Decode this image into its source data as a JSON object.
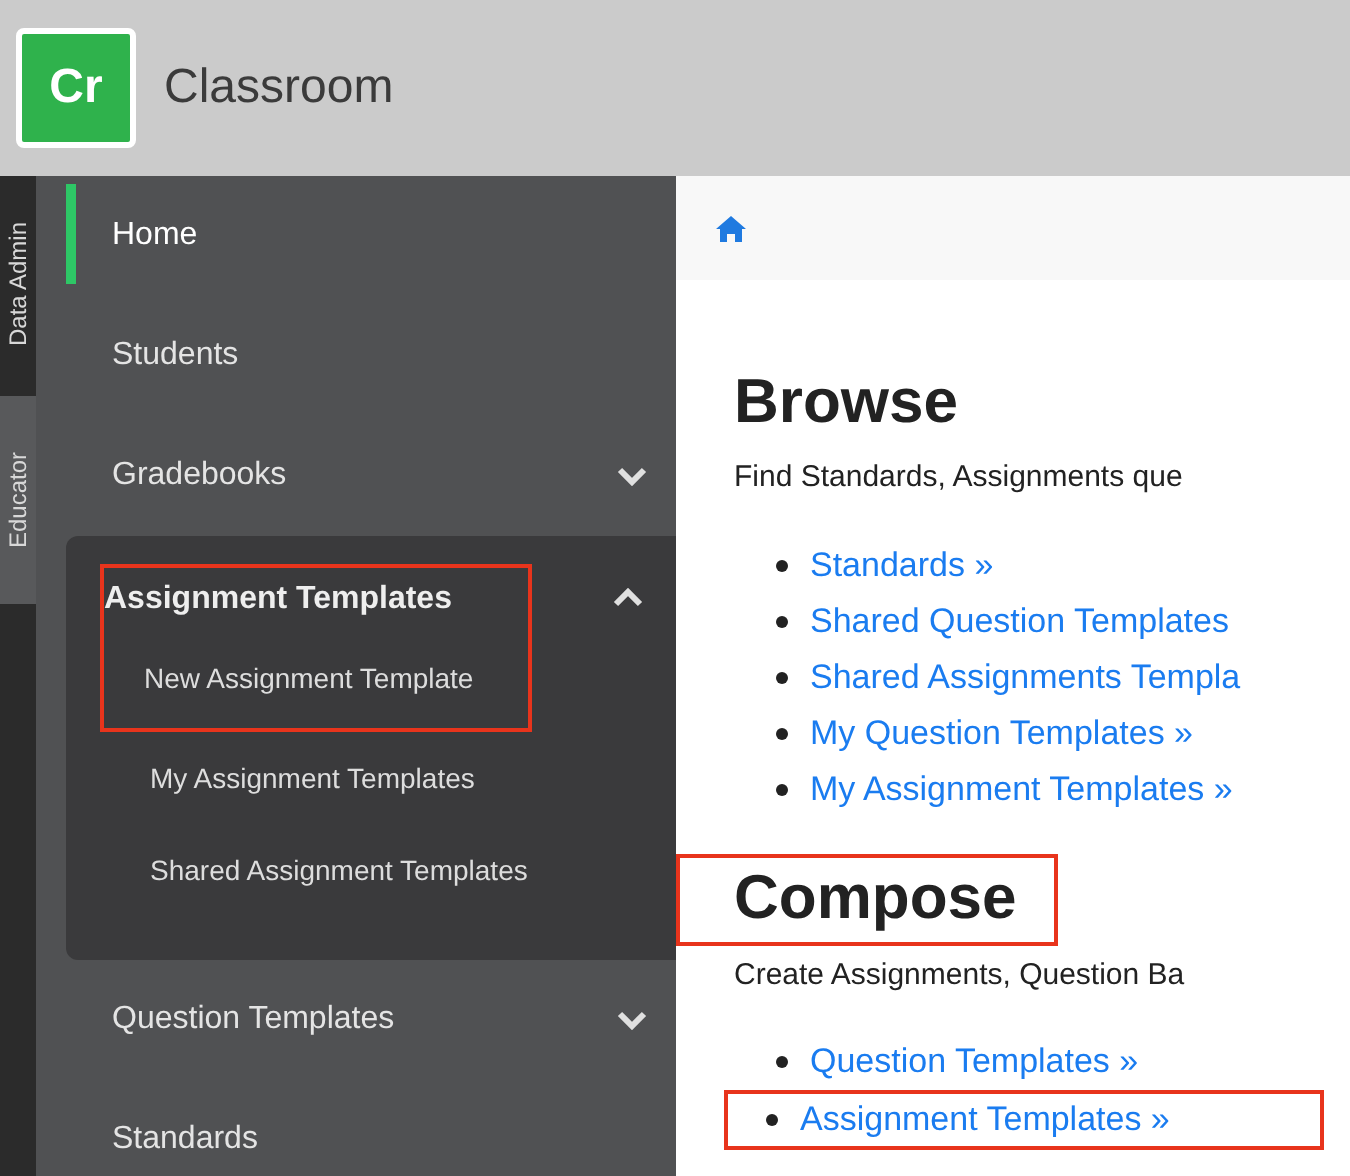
{
  "header": {
    "logo": "Cr",
    "title": "Classroom"
  },
  "role_tabs": [
    {
      "label": "Data Admin",
      "selected": false
    },
    {
      "label": "Educator",
      "selected": true
    }
  ],
  "sidebar": {
    "items": [
      {
        "label": "Home",
        "kind": "link",
        "selected": true
      },
      {
        "label": "Students",
        "kind": "link",
        "selected": false
      },
      {
        "label": "Gradebooks",
        "kind": "group",
        "expanded": false,
        "selected": false
      },
      {
        "label": "Assignment Templates",
        "kind": "group",
        "expanded": true,
        "selected": false,
        "annotated": true,
        "children": [
          {
            "label": "New Assignment Template"
          },
          {
            "label": "My Assignment Templates"
          },
          {
            "label": "Shared Assignment Templates"
          }
        ]
      },
      {
        "label": "Question Templates",
        "kind": "group",
        "expanded": false,
        "selected": false
      },
      {
        "label": "Standards",
        "kind": "link",
        "selected": false
      }
    ]
  },
  "sections": [
    {
      "heading": "Browse",
      "annotated": false,
      "description": "Find Standards, Assignments que",
      "links": [
        {
          "label": "Standards »",
          "annotated": false
        },
        {
          "label": "Shared Question Templates",
          "annotated": false
        },
        {
          "label": "Shared Assignments Templa",
          "annotated": false
        },
        {
          "label": "My Question Templates »",
          "annotated": false
        },
        {
          "label": "My Assignment Templates »",
          "annotated": false
        }
      ]
    },
    {
      "heading": "Compose",
      "annotated": true,
      "description": "Create Assignments, Question Ba",
      "links": [
        {
          "label": "Question Templates »",
          "annotated": false
        },
        {
          "label": "Assignment Templates »",
          "annotated": true
        }
      ]
    }
  ]
}
